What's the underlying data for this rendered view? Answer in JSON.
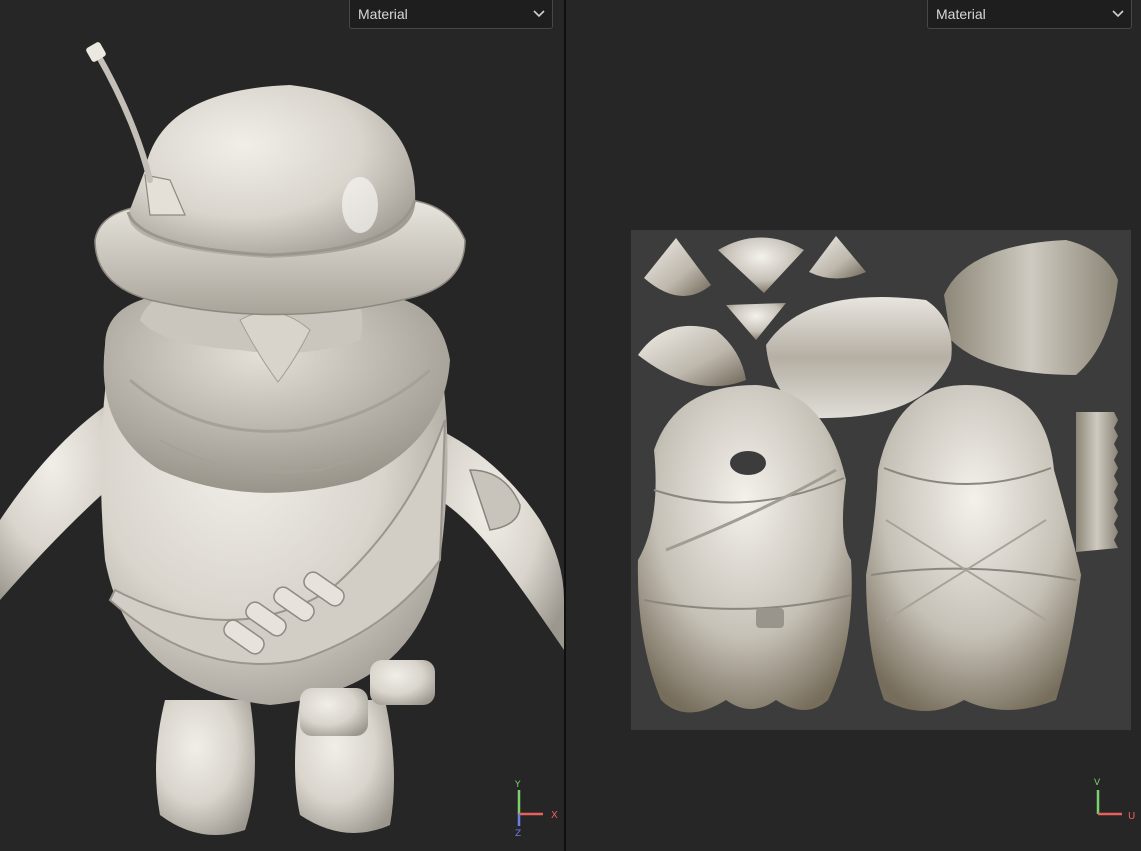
{
  "viewport_3d": {
    "display_mode": "Material",
    "axes": {
      "x": "X",
      "y": "Y",
      "z": "Z"
    }
  },
  "viewport_uv": {
    "display_mode": "Material",
    "axes": {
      "u": "U",
      "v": "V"
    }
  },
  "icons": {
    "dropdown": "chevron-down-icon",
    "gizmo_3d": "axis-gizmo-icon",
    "gizmo_uv": "uv-axis-gizmo-icon"
  },
  "colors": {
    "viewport_bg": "#262626",
    "uv_canvas": "#3c3c3c",
    "model_clay": "#d6d2ca",
    "axis_x": "#e8605c",
    "axis_y": "#7ad26a",
    "axis_z": "#6a7fe8"
  }
}
